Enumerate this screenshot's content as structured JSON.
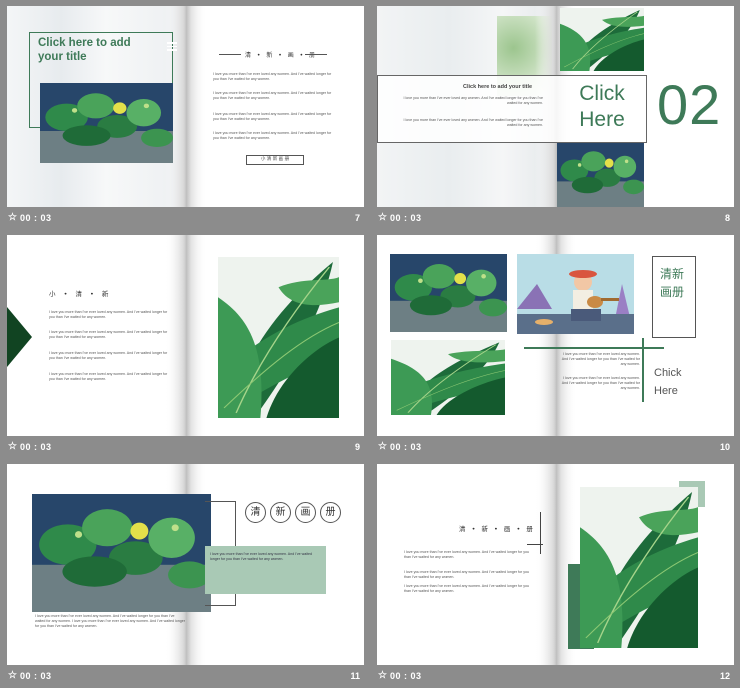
{
  "slides": [
    {
      "time": "00 : 03",
      "number": "7",
      "title": "Click here to add your title",
      "heading": "清 • 新 • 画 • 册",
      "paragraphs": [
        "I love you more than I've ever loved any women. And I've waited longer for you than I've waited for any women.",
        "I love you more than I've ever loved any women. And I've waited longer for you than I've waited for any women.",
        "I love you more than I've ever loved any women. And I've waited longer for you than I've waited for any women.",
        "I love you more than I've ever loved any women. And I've waited longer for you than I've waited for any women."
      ],
      "button": "小 清 新 画 册"
    },
    {
      "time": "00 : 03",
      "number": "8",
      "heading": "Click here to add your title",
      "paragraphs": [
        "I love you more than I've ever loved any women. And I've waited longer for you than I've waited for any women.",
        "I love you more than I've ever loved any women. And I've waited longer for you than I've waited for any women."
      ],
      "big_text": "Click Here",
      "big_number": "02"
    },
    {
      "time": "00 : 03",
      "number": "9",
      "heading": "小 • 清 • 新",
      "paragraphs": [
        "I love you more than I've ever loved any women. And I've waited longer for you than I've waited for any women.",
        "I love you more than I've ever loved any women. And I've waited longer for you than I've waited for any women.",
        "I love you more than I've ever loved any women. And I've waited longer for you than I've waited for any women.",
        "I love you more than I've ever loved any women. And I've waited longer for you than I've waited for any women."
      ]
    },
    {
      "time": "00 : 03",
      "number": "10",
      "vertical_title": "清新画册",
      "paragraphs": [
        "I love you more than I've ever loved any women. And I've waited longer for you than I've waited for any women.",
        "I love you more than I've ever loved any women. And I've waited longer for you than I've waited for any women."
      ],
      "side_text": "Chick Here"
    },
    {
      "time": "00 : 03",
      "number": "11",
      "circles": [
        "清",
        "新",
        "画",
        "册"
      ],
      "paragraphs": [
        "I love you more than I've ever loved any women. And I've waited longer for you than I've waited for any women.",
        "I love you more than I've ever loved any women. And I've waited longer for you than I've waited for any women. I love you more than I've ever loved any women. And I've waited longer for you than I've waited for any women."
      ]
    },
    {
      "time": "00 : 03",
      "number": "12",
      "heading": "清 • 新 • 画 • 册",
      "paragraphs": [
        "I love you more than I've ever loved any women. And I've waited longer for you than I've waited for any women.",
        "I love you more than I've ever loved any women. And I've waited longer for you than I've waited for any women.",
        "I love you more than I've ever loved any women. And I've waited longer for you than I've waited for any women."
      ]
    }
  ],
  "colors": {
    "accent": "#3e7a58",
    "dark_green": "#114422",
    "background": "#8c8c8c"
  },
  "icons": {
    "timer": "star-timer-icon"
  }
}
